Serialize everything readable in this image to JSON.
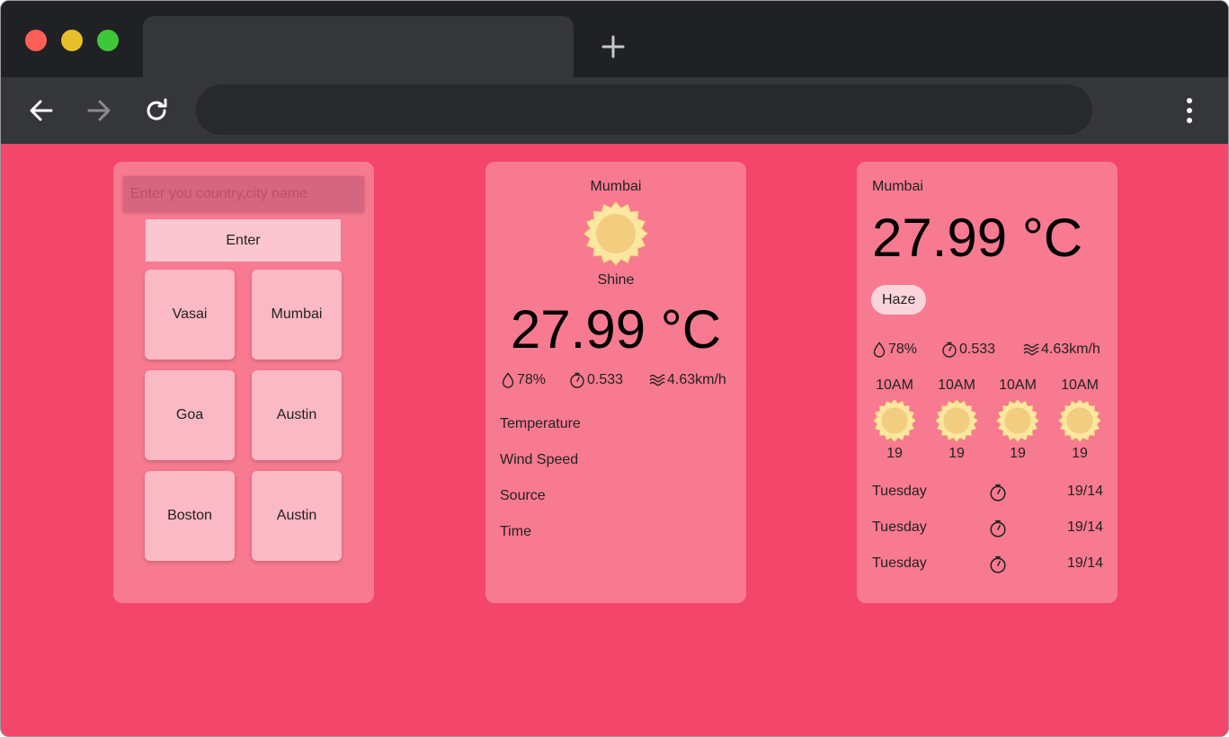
{
  "browser": {
    "new_tab_icon": "plus-icon",
    "back_icon": "arrow-left-icon",
    "forward_icon": "arrow-right-icon",
    "reload_icon": "reload-icon",
    "menu_icon": "kebab-menu-icon"
  },
  "colors": {
    "page_bg": "#f4456a",
    "card_bg": "#f77a90",
    "tile_bg": "#fbb8c5",
    "sun": "#f2cd80"
  },
  "search": {
    "placeholder": "Enter you country,city name",
    "value": "",
    "button_label": "Enter"
  },
  "cities": [
    "Vasai",
    "Mumbai",
    "Goa",
    "Austin",
    "Boston",
    "Austin"
  ],
  "current": {
    "city": "Mumbai",
    "icon": "sun-icon",
    "condition": "Shine",
    "temperature": "27.99 °C",
    "humidity": "78%",
    "pressure": "0.533",
    "wind": "4.63km/h",
    "labels": [
      "Temperature",
      "Wind Speed",
      "Source",
      "Time"
    ]
  },
  "forecast": {
    "city": "Mumbai",
    "temperature": "27.99 °C",
    "badge": "Haze",
    "humidity": "78%",
    "pressure": "0.533",
    "wind": "4.63km/h",
    "hourly": [
      {
        "time": "10AM",
        "icon": "sun-icon",
        "value": "19"
      },
      {
        "time": "10AM",
        "icon": "sun-icon",
        "value": "19"
      },
      {
        "time": "10AM",
        "icon": "sun-icon",
        "value": "19"
      },
      {
        "time": "10AM",
        "icon": "sun-icon",
        "value": "19"
      }
    ],
    "daily": [
      {
        "day": "Tuesday",
        "icon": "stopwatch-icon",
        "value": "19/14"
      },
      {
        "day": "Tuesday",
        "icon": "stopwatch-icon",
        "value": "19/14"
      },
      {
        "day": "Tuesday",
        "icon": "stopwatch-icon",
        "value": "19/14"
      }
    ]
  }
}
